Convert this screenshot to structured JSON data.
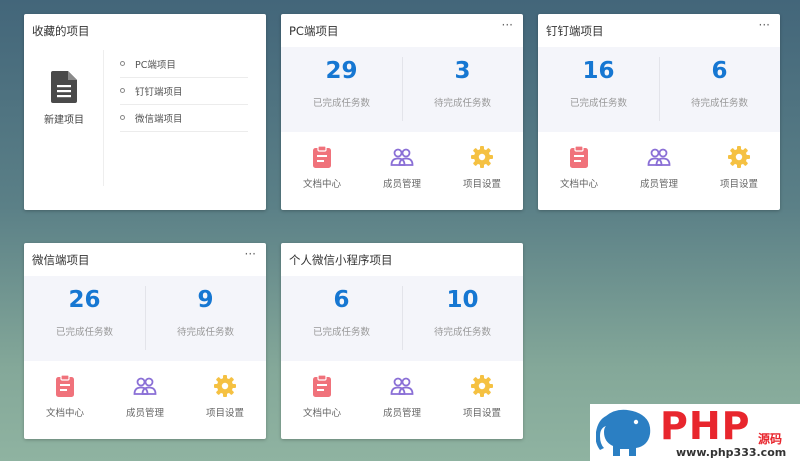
{
  "favorites": {
    "title": "收藏的项目",
    "new_label": "新建项目",
    "items": [
      "PC端项目",
      "钉钉端项目",
      "微信端项目"
    ]
  },
  "cards": [
    {
      "title": "PC端项目",
      "done": "29",
      "todo": "3"
    },
    {
      "title": "钉钉端项目",
      "done": "16",
      "todo": "6"
    },
    {
      "title": "微信端项目",
      "done": "26",
      "todo": "9"
    },
    {
      "title": "个人微信小程序项目",
      "done": "6",
      "todo": "10"
    }
  ],
  "labels": {
    "done": "已完成任务数",
    "todo": "待完成任务数",
    "docs": "文档中心",
    "members": "成员管理",
    "settings": "项目设置",
    "more": "···"
  },
  "icons": {
    "new_project": "document-icon",
    "docs": "clipboard-icon",
    "members": "users-icon",
    "settings": "gear-icon"
  },
  "colors": {
    "number": "#1677d2",
    "docs_icon": "#f0727b",
    "members_icon": "#8a6fd6",
    "settings_icon": "#f5c142",
    "watermark": "#e8262d"
  },
  "watermark": {
    "brand": "PHP",
    "suffix": "源码",
    "url": "www.php333.com"
  }
}
